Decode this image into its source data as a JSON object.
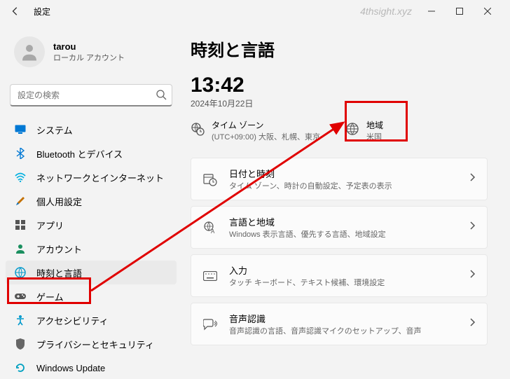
{
  "window": {
    "title": "設定",
    "watermark": "4thsight.xyz"
  },
  "user": {
    "name": "tarou",
    "sub": "ローカル アカウント"
  },
  "search": {
    "placeholder": "設定の検索"
  },
  "sidebar": {
    "items": [
      {
        "label": "システム"
      },
      {
        "label": "Bluetooth とデバイス"
      },
      {
        "label": "ネットワークとインターネット"
      },
      {
        "label": "個人用設定"
      },
      {
        "label": "アプリ"
      },
      {
        "label": "アカウント"
      },
      {
        "label": "時刻と言語"
      },
      {
        "label": "ゲーム"
      },
      {
        "label": "アクセシビリティ"
      },
      {
        "label": "プライバシーとセキュリティ"
      },
      {
        "label": "Windows Update"
      }
    ]
  },
  "page": {
    "title": "時刻と言語",
    "clock": "13:42",
    "date": "2024年10月22日",
    "timezone": {
      "label": "タイム ゾーン",
      "detail": "(UTC+09:00) 大阪、札幌、東京"
    },
    "region": {
      "label": "地域",
      "detail": "米国"
    },
    "cards": [
      {
        "title": "日付と時刻",
        "sub": "タイム ゾーン、時計の自動設定、予定表の表示"
      },
      {
        "title": "言語と地域",
        "sub": "Windows 表示言語、優先する言語、地域設定"
      },
      {
        "title": "入力",
        "sub": "タッチ キーボード、テキスト候補、環境設定"
      },
      {
        "title": "音声認識",
        "sub": "音声認識の言語、音声認識マイクのセットアップ、音声"
      }
    ]
  }
}
